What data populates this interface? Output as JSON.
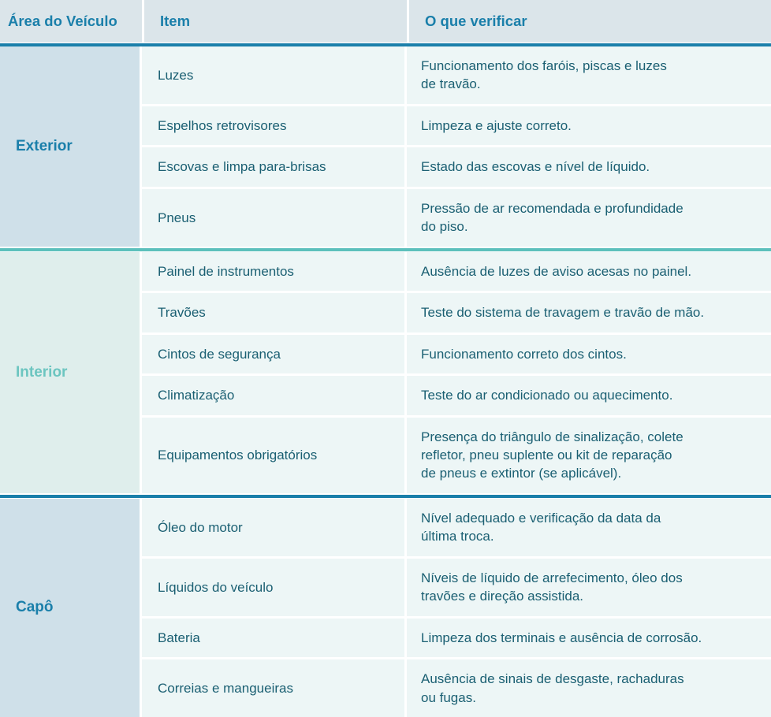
{
  "table": {
    "headers": {
      "area": "Área do Veículo",
      "item": "Item",
      "check": "O que verificar"
    },
    "colors": {
      "header_background": "#dbe5ea",
      "header_text": "#1a7faa",
      "header_rule": "#1a7faa",
      "area_exterior_background": "#cfe0e9",
      "area_exterior_text": "#1a7faa",
      "area_interior_background": "#dfeeec",
      "area_interior_text": "#6cc5c0",
      "area_capo_background": "#cfe0e9",
      "area_capo_text": "#1a7faa",
      "cell_background": "#edf6f6",
      "cell_text": "#1a5f72",
      "divider_teal": "#5cc0bc",
      "divider_blue": "#1a7faa",
      "gap": "#ffffff"
    },
    "sections": [
      {
        "area": "Exterior",
        "divider_after": "teal",
        "rows": [
          {
            "item": "Luzes",
            "check": [
              "Funcionamento dos faróis, piscas e luzes",
              "de travão."
            ]
          },
          {
            "item": "Espelhos retrovisores",
            "check": [
              "Limpeza e ajuste correto."
            ]
          },
          {
            "item": "Escovas e limpa para-brisas",
            "check": [
              "Estado das escovas e nível de líquido."
            ]
          },
          {
            "item": "Pneus",
            "check": [
              "Pressão de ar recomendada e profundidade",
              "do piso."
            ]
          }
        ]
      },
      {
        "area": "Interior",
        "divider_after": "blue",
        "rows": [
          {
            "item": "Painel de instrumentos",
            "check": [
              "Ausência de luzes de aviso acesas no painel."
            ]
          },
          {
            "item": "Travões",
            "check": [
              "Teste do sistema de travagem e travão de mão."
            ]
          },
          {
            "item": "Cintos de segurança",
            "check": [
              "Funcionamento correto dos cintos."
            ]
          },
          {
            "item": "Climatização",
            "check": [
              "Teste do ar condicionado ou aquecimento."
            ]
          },
          {
            "item": "Equipamentos obrigatórios",
            "check": [
              "Presença do triângulo de sinalização, colete",
              "refletor, pneu suplente ou kit de reparação",
              "de pneus e extintor (se aplicável)."
            ]
          }
        ]
      },
      {
        "area": "Capô",
        "divider_after": null,
        "rows": [
          {
            "item": "Óleo do motor",
            "check": [
              "Nível adequado e verificação da data da",
              "última troca."
            ]
          },
          {
            "item": "Líquidos do veículo",
            "check": [
              "Níveis de líquido de arrefecimento, óleo dos",
              "travões e direção assistida."
            ]
          },
          {
            "item": "Bateria",
            "check": [
              "Limpeza dos terminais e ausência de corrosão."
            ]
          },
          {
            "item": "Correias e mangueiras",
            "check": [
              "Ausência de sinais de desgaste, rachaduras",
              "ou fugas."
            ]
          }
        ]
      }
    ]
  }
}
